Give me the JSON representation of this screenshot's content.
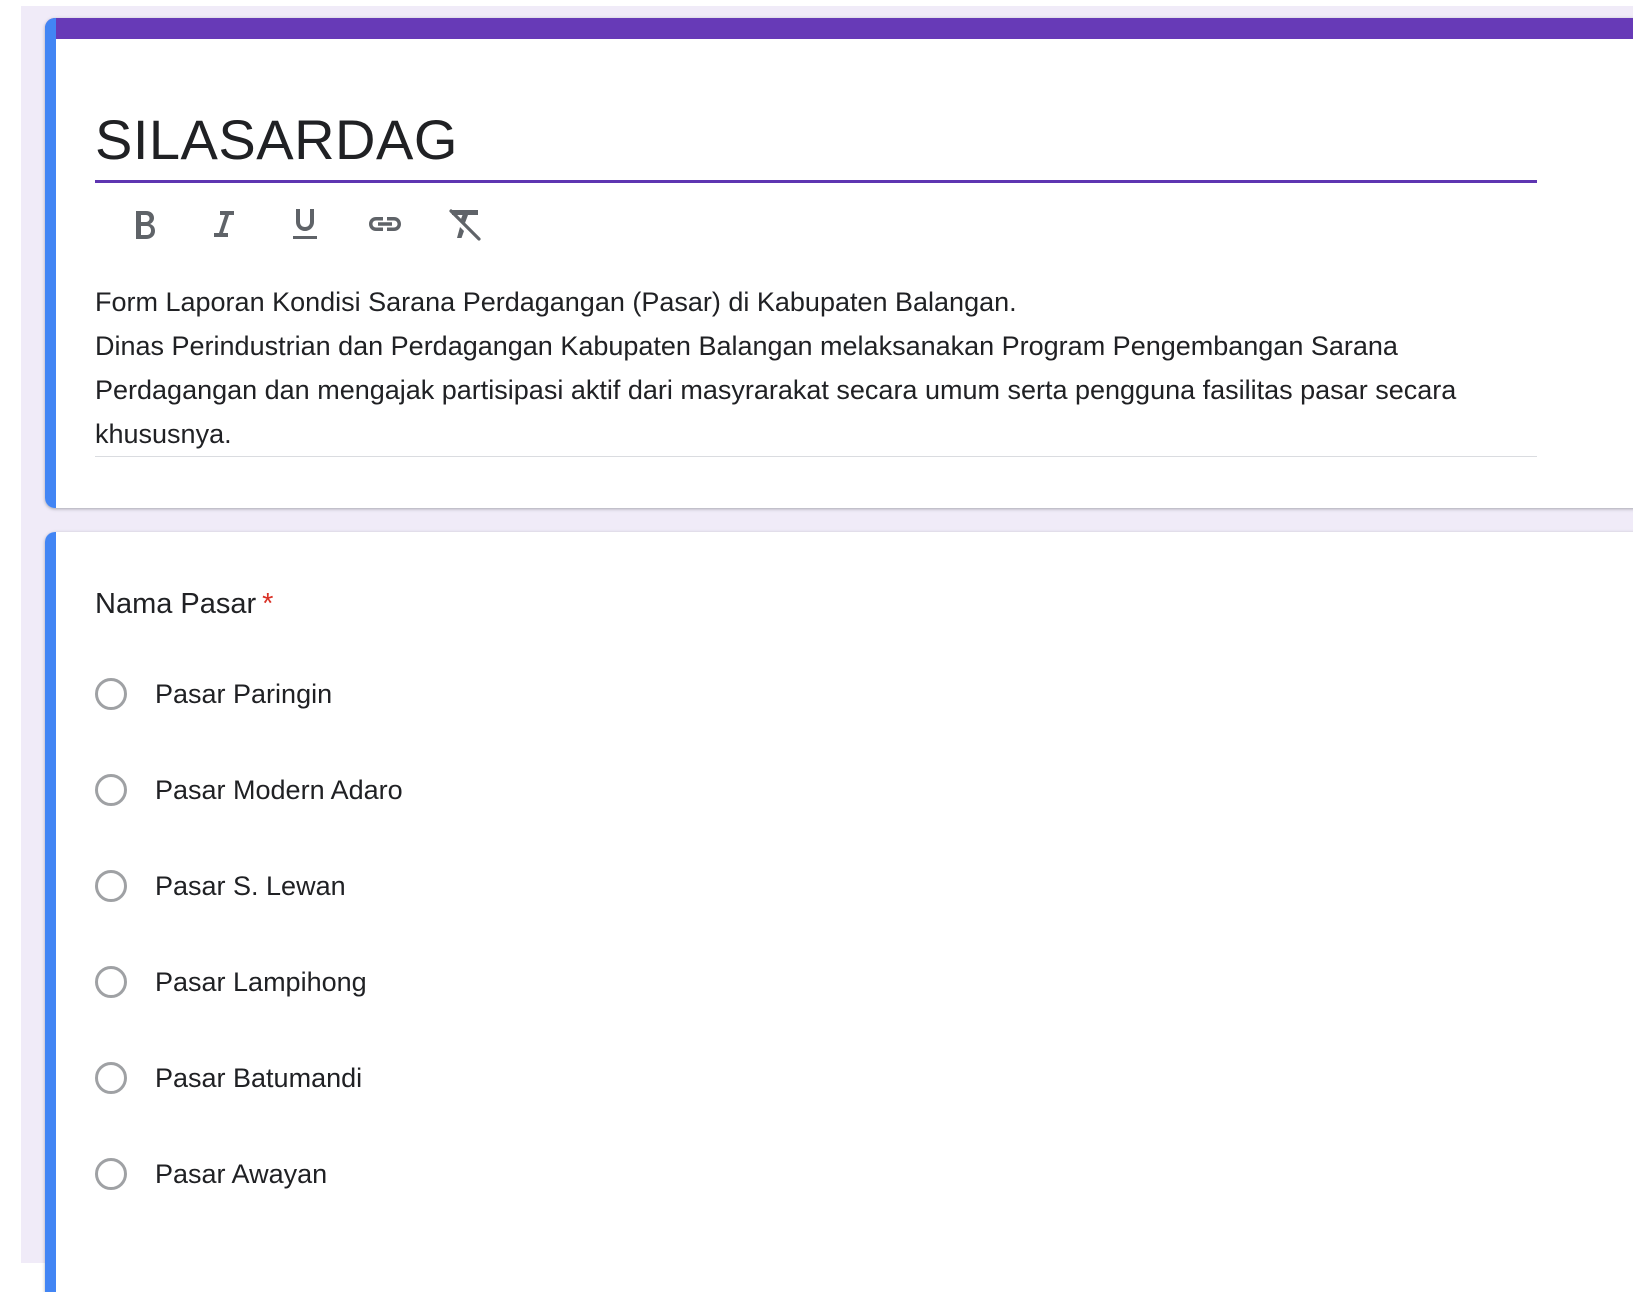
{
  "form": {
    "title": "SILASARDAG",
    "toolbar": {
      "bold_icon": "bold-icon",
      "italic_icon": "italic-icon",
      "underline_icon": "underline-icon",
      "link_icon": "link-icon",
      "clear_format_icon": "clear-formatting-icon"
    },
    "description": {
      "line1": "Form Laporan Kondisi Sarana Perdagangan (Pasar) di Kabupaten Balangan.",
      "line2": "Dinas Perindustrian dan Perdagangan Kabupaten Balangan melaksanakan Program Pengembangan Sarana Perdagangan dan mengajak partisipasi aktif dari masyrarakat secara umum serta pengguna fasilitas pasar secara khususnya."
    }
  },
  "question": {
    "title": "Nama Pasar",
    "required_mark": "*",
    "options": [
      "Pasar Paringin",
      "Pasar Modern Adaro",
      "Pasar S. Lewan",
      "Pasar Lampihong",
      "Pasar Batumandi",
      "Pasar Awayan"
    ]
  },
  "colors": {
    "theme_purple": "#673ab7",
    "accent_blue": "#4285f4",
    "background": "#f0ebf8",
    "required_red": "#d93025"
  }
}
